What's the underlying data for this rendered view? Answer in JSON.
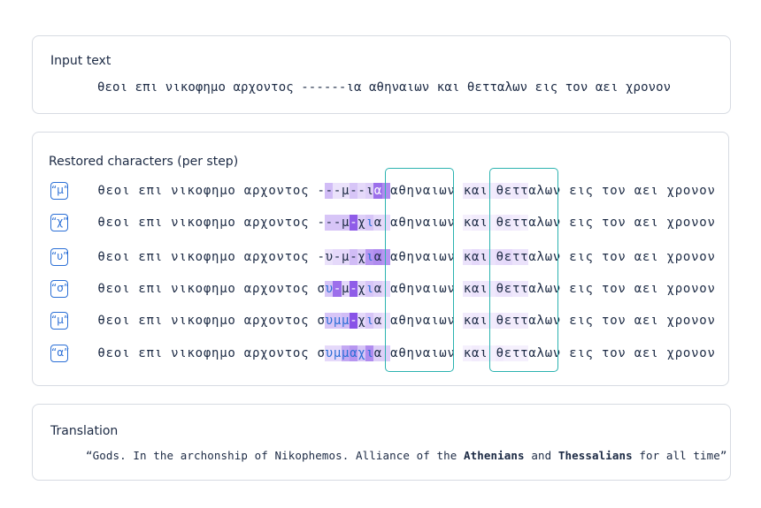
{
  "input": {
    "title": "Input text",
    "text": "θεοι επι νικοφημο αρχοντος ------ια αθηναιων και θετταλων εις τον αει χρονον"
  },
  "restoration": {
    "title": "Restored characters (per step)",
    "steps": [
      {
        "char": "“μ”",
        "text": "θεοι επι νικοφημο αρχοντος ---μ--ια αθηναιων και θετταλων εις τον αει χρονον"
      },
      {
        "char": "“χ”",
        "text": "θεοι επι νικοφημο αρχοντος ---μ-χια αθηναιων και θετταλων εις τον αει χρονον"
      },
      {
        "char": "“υ”",
        "text": "θεοι επι νικοφημο αρχοντος -υ-μ-χια αθηναιων και θετταλων εις τον αει χρονον"
      },
      {
        "char": "“σ”",
        "text": "θεοι επι νικοφημο αρχοντος συ-μ-χια αθηναιων και θετταλων εις τον αει χρονον"
      },
      {
        "char": "“μ”",
        "text": "θεοι επι νικοφημο αρχοντος συμμ-χια αθηναιων και θετταλων εις τον αει χρονον"
      },
      {
        "char": "“α”",
        "text": "θεοι επι νικοφημο αρχοντος συμμαχια αθηναιων και θετταλων εις τον αει χρονον"
      }
    ]
  },
  "translation": {
    "title": "Translation",
    "parts": [
      "“Gods. In the archonship of Nikophemos. Alliance of the ",
      "Athenians",
      " and ",
      "Thessalians",
      " for all time”"
    ]
  },
  "colors": {
    "accent": "#2b6fd6",
    "highlight_box": "#2bb3b0",
    "attention": "#7b3fe4"
  }
}
